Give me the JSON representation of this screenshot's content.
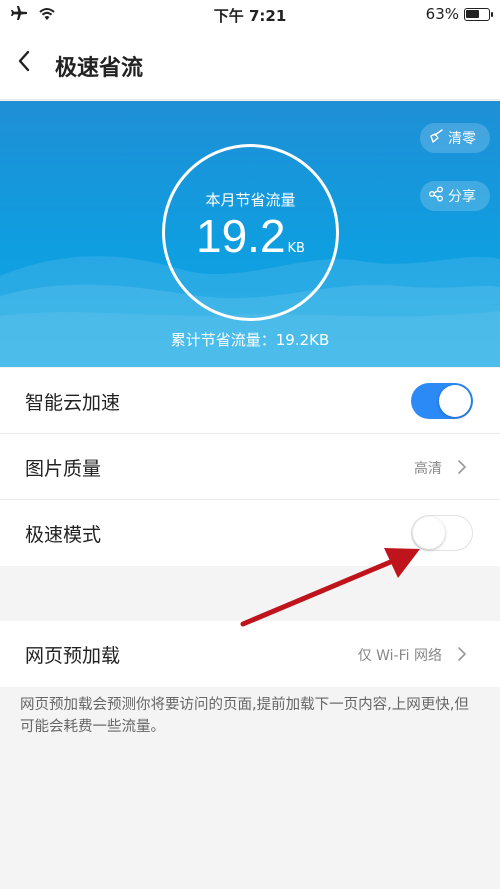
{
  "status_bar": {
    "time": "下午 7:21",
    "battery_percent": "63%",
    "battery_level": 0.63,
    "icons": [
      "airplane-icon",
      "wifi-icon",
      "battery-icon"
    ]
  },
  "nav": {
    "title": "极速省流",
    "back_icon": "chevron-left-icon"
  },
  "hero": {
    "circle_label": "本月节省流量",
    "value": "19.2",
    "unit": "KB",
    "total_text": "累计节省流量：19.2KB",
    "clear_label": "清零",
    "share_label": "分享",
    "background_color": "#1a9ade"
  },
  "settings": {
    "group1": [
      {
        "label": "智能云加速",
        "control": "toggle",
        "on": true
      },
      {
        "label": "图片质量",
        "value": "高清",
        "control": "chevron"
      },
      {
        "label": "极速模式",
        "control": "toggle",
        "on": false
      }
    ],
    "group2": [
      {
        "label": "网页预加载",
        "value": "仅 Wi-Fi 网络",
        "control": "chevron"
      }
    ],
    "preload_description": "网页预加载会预测你将要访问的页面,提前加载下一页内容,上网更快,但可能会耗费一些流量。"
  },
  "colors": {
    "accent": "#2b8af6",
    "annotation_arrow": "#c0141d"
  }
}
